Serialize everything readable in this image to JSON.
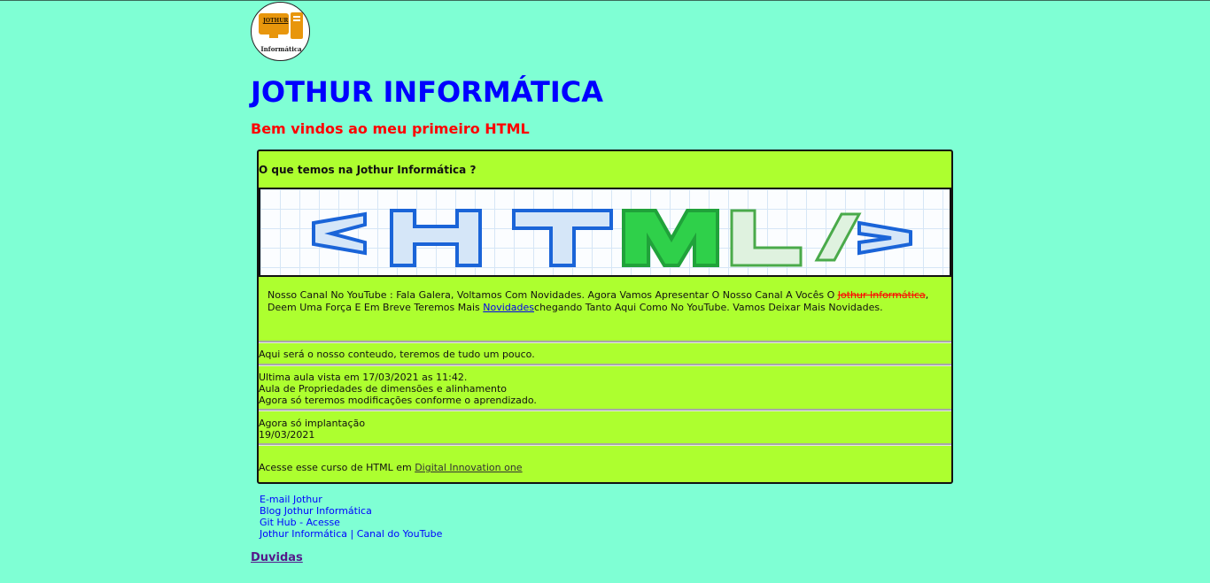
{
  "logo": {
    "brand_text": "JOTHUR",
    "caption": "Informática"
  },
  "header": {
    "title": "JOTHUR INFORMÁTICA",
    "subtitle": "Bem vindos ao meu primeiro HTML"
  },
  "panel": {
    "question": "O que temos na Jothur Informática ?",
    "banner_text": "<HTML/>",
    "youtube": {
      "part1": "Nosso Canal No YouTube : Fala Galera, Voltamos Com Novidades. Agora Vamos Apresentar O Nosso Canal A Vocês O ",
      "strike": "Jothur Informática",
      "part2": ", Deem Uma Força E Em Breve Teremos Mais ",
      "link": "Novidades",
      "part3": "chegando Tanto Aqui Como No YouTube. Vamos Deixar Mais Novidades."
    },
    "content_line": "Aqui será o nosso conteudo, teremos de tudo um pouco.",
    "last_class": {
      "line1": "Ultima aula vista em 17/03/2021 as 11:42.",
      "line2": "Aula de Propriedades de dimensões e alinhamento",
      "line3": "Agora só teremos modificações conforme o aprendizado."
    },
    "implant": {
      "line1": "Agora só implantação",
      "line2": "19/03/2021"
    },
    "course": {
      "prefix": "Acesse esse curso de HTML em ",
      "link": "Digital Innovation one"
    }
  },
  "footer_links": [
    "E-mail Jothur",
    "Blog Jothur Informática",
    "Git Hub - Acesse",
    "Jothur Informática | Canal do YouTube"
  ],
  "duvidas": "Duvidas",
  "colors": {
    "background": "#7fffd4",
    "panel": "#adff2f",
    "title": "#0000ff",
    "subtitle": "#ff0000"
  }
}
